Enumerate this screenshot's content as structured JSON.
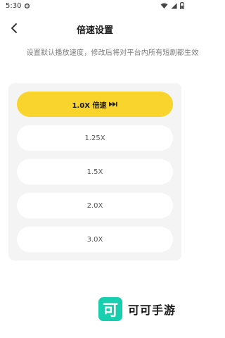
{
  "status_bar": {
    "time": "5:30"
  },
  "header": {
    "title": "倍速设置"
  },
  "subtitle": "设置默认播放速度，修改后将对平台内所有短剧都生效",
  "speeds": [
    {
      "label": "1.0X 倍速",
      "selected": true
    },
    {
      "label": "1.25X",
      "selected": false
    },
    {
      "label": "1.5X",
      "selected": false
    },
    {
      "label": "2.0X",
      "selected": false
    },
    {
      "label": "3.0X",
      "selected": false
    }
  ],
  "brand": {
    "logo_char": "可",
    "name": "可可手游"
  },
  "colors": {
    "accent": "#f9d42c",
    "panel_bg": "#f4f4f4",
    "logo_bg": "#17cfae"
  }
}
